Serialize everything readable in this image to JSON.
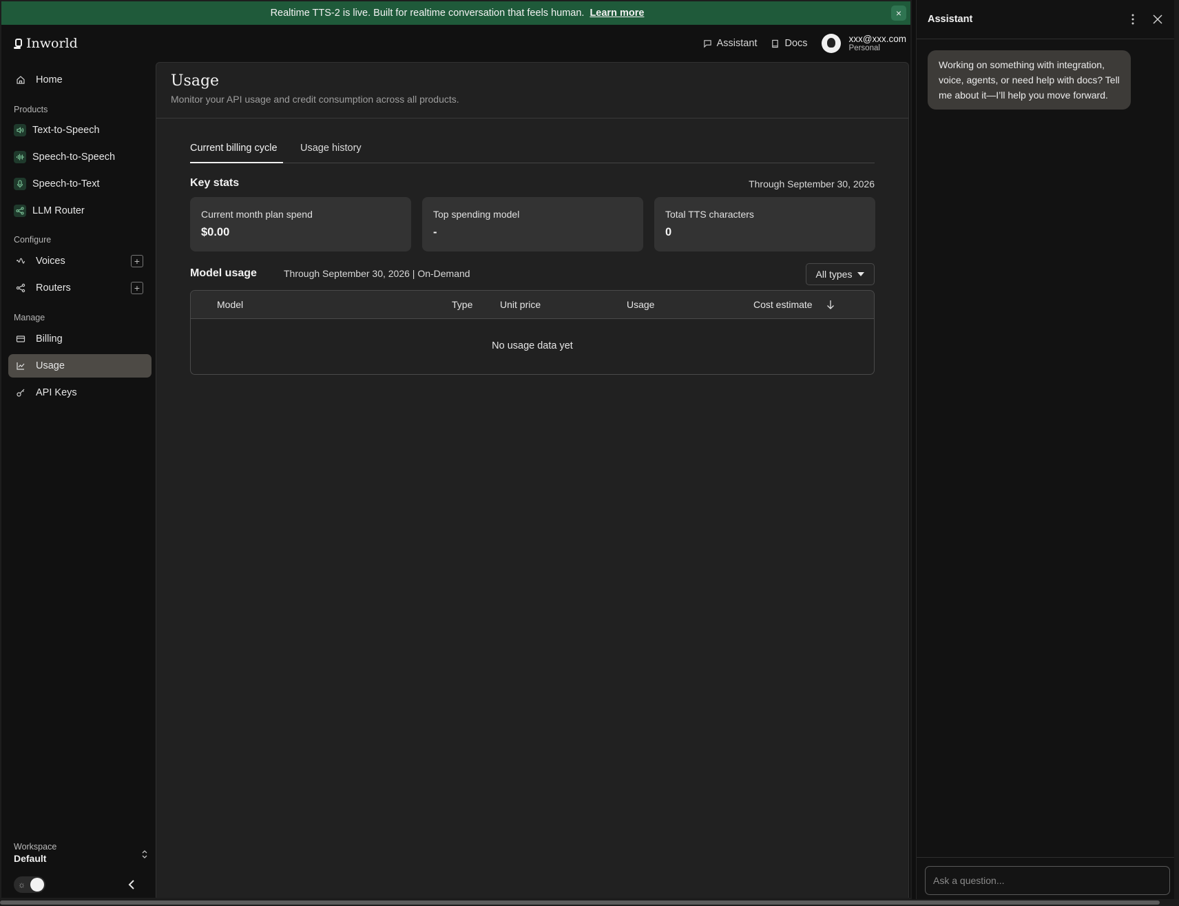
{
  "banner": {
    "text": "Realtime TTS-2 is live. Built for realtime conversation that feels human.",
    "link": "Learn more",
    "close": "×"
  },
  "header": {
    "logo": "Inworld",
    "assistant_link": "Assistant",
    "docs_link": "Docs",
    "user_email": "xxx@xxx.com",
    "user_plan": "Personal"
  },
  "sidebar": {
    "home": "Home",
    "products_label": "Products",
    "products": [
      "Text-to-Speech",
      "Speech-to-Speech",
      "Speech-to-Text",
      "LLM Router"
    ],
    "configure_label": "Configure",
    "voices": "Voices",
    "routers": "Routers",
    "manage_label": "Manage",
    "billing": "Billing",
    "usage": "Usage",
    "api_keys": "API Keys",
    "workspace_label": "Workspace",
    "workspace_value": "Default"
  },
  "main": {
    "title": "Usage",
    "subtitle": "Monitor your API usage and credit consumption across all products.",
    "tabs": [
      "Current billing cycle",
      "Usage history"
    ],
    "key_stats_title": "Key stats",
    "key_stats_date": "Through September 30, 2026",
    "stats": [
      {
        "label": "Current month plan spend",
        "value": "$0.00"
      },
      {
        "label": "Top spending model",
        "value": "-"
      },
      {
        "label": "Total TTS characters",
        "value": "0"
      }
    ],
    "model_usage_title": "Model usage",
    "model_usage_date": "Through September 30, 2026 | On-Demand",
    "filter_label": "All types",
    "table_headers": [
      "Model",
      "Type",
      "Unit price",
      "Usage",
      "Cost estimate"
    ],
    "empty_message": "No usage data yet"
  },
  "assistant": {
    "title": "Assistant",
    "message": "Working on something with integration, voice, agents, or need help with docs? Tell me about it—I’ll help you move forward.",
    "input_placeholder": "Ask a question..."
  },
  "colors": {
    "banner": "#1f5a3a",
    "active_nav": "#4d4a45",
    "product_icon_bg": "#1f3a2c"
  }
}
